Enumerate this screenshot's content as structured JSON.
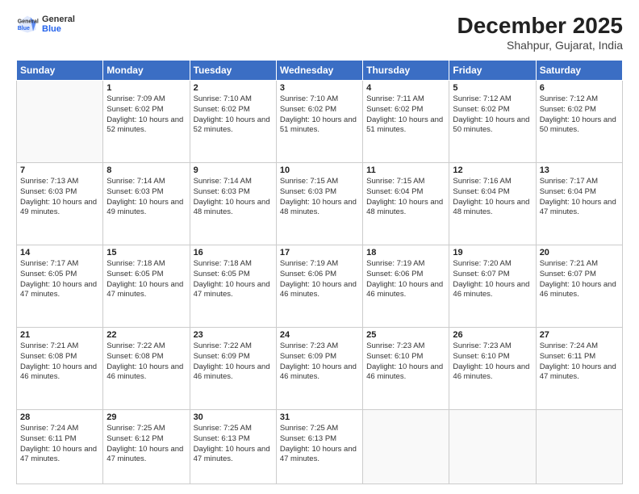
{
  "header": {
    "logo_line1": "General",
    "logo_line2": "Blue",
    "month": "December 2025",
    "location": "Shahpur, Gujarat, India"
  },
  "days_of_week": [
    "Sunday",
    "Monday",
    "Tuesday",
    "Wednesday",
    "Thursday",
    "Friday",
    "Saturday"
  ],
  "weeks": [
    [
      {
        "day": "",
        "sunrise": "",
        "sunset": "",
        "daylight": ""
      },
      {
        "day": "1",
        "sunrise": "Sunrise: 7:09 AM",
        "sunset": "Sunset: 6:02 PM",
        "daylight": "Daylight: 10 hours and 52 minutes."
      },
      {
        "day": "2",
        "sunrise": "Sunrise: 7:10 AM",
        "sunset": "Sunset: 6:02 PM",
        "daylight": "Daylight: 10 hours and 52 minutes."
      },
      {
        "day": "3",
        "sunrise": "Sunrise: 7:10 AM",
        "sunset": "Sunset: 6:02 PM",
        "daylight": "Daylight: 10 hours and 51 minutes."
      },
      {
        "day": "4",
        "sunrise": "Sunrise: 7:11 AM",
        "sunset": "Sunset: 6:02 PM",
        "daylight": "Daylight: 10 hours and 51 minutes."
      },
      {
        "day": "5",
        "sunrise": "Sunrise: 7:12 AM",
        "sunset": "Sunset: 6:02 PM",
        "daylight": "Daylight: 10 hours and 50 minutes."
      },
      {
        "day": "6",
        "sunrise": "Sunrise: 7:12 AM",
        "sunset": "Sunset: 6:02 PM",
        "daylight": "Daylight: 10 hours and 50 minutes."
      }
    ],
    [
      {
        "day": "7",
        "sunrise": "Sunrise: 7:13 AM",
        "sunset": "Sunset: 6:03 PM",
        "daylight": "Daylight: 10 hours and 49 minutes."
      },
      {
        "day": "8",
        "sunrise": "Sunrise: 7:14 AM",
        "sunset": "Sunset: 6:03 PM",
        "daylight": "Daylight: 10 hours and 49 minutes."
      },
      {
        "day": "9",
        "sunrise": "Sunrise: 7:14 AM",
        "sunset": "Sunset: 6:03 PM",
        "daylight": "Daylight: 10 hours and 48 minutes."
      },
      {
        "day": "10",
        "sunrise": "Sunrise: 7:15 AM",
        "sunset": "Sunset: 6:03 PM",
        "daylight": "Daylight: 10 hours and 48 minutes."
      },
      {
        "day": "11",
        "sunrise": "Sunrise: 7:15 AM",
        "sunset": "Sunset: 6:04 PM",
        "daylight": "Daylight: 10 hours and 48 minutes."
      },
      {
        "day": "12",
        "sunrise": "Sunrise: 7:16 AM",
        "sunset": "Sunset: 6:04 PM",
        "daylight": "Daylight: 10 hours and 48 minutes."
      },
      {
        "day": "13",
        "sunrise": "Sunrise: 7:17 AM",
        "sunset": "Sunset: 6:04 PM",
        "daylight": "Daylight: 10 hours and 47 minutes."
      }
    ],
    [
      {
        "day": "14",
        "sunrise": "Sunrise: 7:17 AM",
        "sunset": "Sunset: 6:05 PM",
        "daylight": "Daylight: 10 hours and 47 minutes."
      },
      {
        "day": "15",
        "sunrise": "Sunrise: 7:18 AM",
        "sunset": "Sunset: 6:05 PM",
        "daylight": "Daylight: 10 hours and 47 minutes."
      },
      {
        "day": "16",
        "sunrise": "Sunrise: 7:18 AM",
        "sunset": "Sunset: 6:05 PM",
        "daylight": "Daylight: 10 hours and 47 minutes."
      },
      {
        "day": "17",
        "sunrise": "Sunrise: 7:19 AM",
        "sunset": "Sunset: 6:06 PM",
        "daylight": "Daylight: 10 hours and 46 minutes."
      },
      {
        "day": "18",
        "sunrise": "Sunrise: 7:19 AM",
        "sunset": "Sunset: 6:06 PM",
        "daylight": "Daylight: 10 hours and 46 minutes."
      },
      {
        "day": "19",
        "sunrise": "Sunrise: 7:20 AM",
        "sunset": "Sunset: 6:07 PM",
        "daylight": "Daylight: 10 hours and 46 minutes."
      },
      {
        "day": "20",
        "sunrise": "Sunrise: 7:21 AM",
        "sunset": "Sunset: 6:07 PM",
        "daylight": "Daylight: 10 hours and 46 minutes."
      }
    ],
    [
      {
        "day": "21",
        "sunrise": "Sunrise: 7:21 AM",
        "sunset": "Sunset: 6:08 PM",
        "daylight": "Daylight: 10 hours and 46 minutes."
      },
      {
        "day": "22",
        "sunrise": "Sunrise: 7:22 AM",
        "sunset": "Sunset: 6:08 PM",
        "daylight": "Daylight: 10 hours and 46 minutes."
      },
      {
        "day": "23",
        "sunrise": "Sunrise: 7:22 AM",
        "sunset": "Sunset: 6:09 PM",
        "daylight": "Daylight: 10 hours and 46 minutes."
      },
      {
        "day": "24",
        "sunrise": "Sunrise: 7:23 AM",
        "sunset": "Sunset: 6:09 PM",
        "daylight": "Daylight: 10 hours and 46 minutes."
      },
      {
        "day": "25",
        "sunrise": "Sunrise: 7:23 AM",
        "sunset": "Sunset: 6:10 PM",
        "daylight": "Daylight: 10 hours and 46 minutes."
      },
      {
        "day": "26",
        "sunrise": "Sunrise: 7:23 AM",
        "sunset": "Sunset: 6:10 PM",
        "daylight": "Daylight: 10 hours and 46 minutes."
      },
      {
        "day": "27",
        "sunrise": "Sunrise: 7:24 AM",
        "sunset": "Sunset: 6:11 PM",
        "daylight": "Daylight: 10 hours and 47 minutes."
      }
    ],
    [
      {
        "day": "28",
        "sunrise": "Sunrise: 7:24 AM",
        "sunset": "Sunset: 6:11 PM",
        "daylight": "Daylight: 10 hours and 47 minutes."
      },
      {
        "day": "29",
        "sunrise": "Sunrise: 7:25 AM",
        "sunset": "Sunset: 6:12 PM",
        "daylight": "Daylight: 10 hours and 47 minutes."
      },
      {
        "day": "30",
        "sunrise": "Sunrise: 7:25 AM",
        "sunset": "Sunset: 6:13 PM",
        "daylight": "Daylight: 10 hours and 47 minutes."
      },
      {
        "day": "31",
        "sunrise": "Sunrise: 7:25 AM",
        "sunset": "Sunset: 6:13 PM",
        "daylight": "Daylight: 10 hours and 47 minutes."
      },
      {
        "day": "",
        "sunrise": "",
        "sunset": "",
        "daylight": ""
      },
      {
        "day": "",
        "sunrise": "",
        "sunset": "",
        "daylight": ""
      },
      {
        "day": "",
        "sunrise": "",
        "sunset": "",
        "daylight": ""
      }
    ]
  ]
}
